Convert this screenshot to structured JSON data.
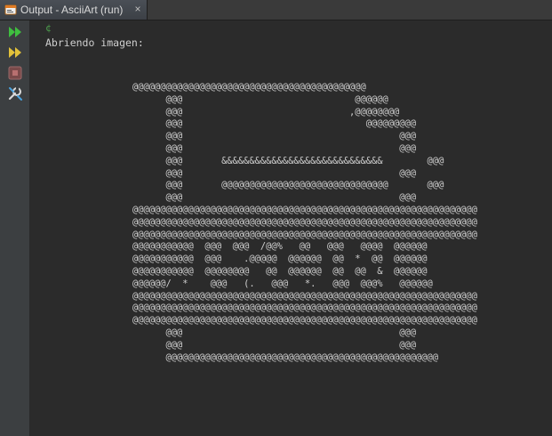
{
  "tab": {
    "title": "Output - AsciiArt (run)",
    "close_glyph": "×",
    "icon": "output-window-icon"
  },
  "toolbar": {
    "items": [
      {
        "icon": "rerun-icon",
        "label": "Re-run"
      },
      {
        "icon": "rerun-with-params-icon",
        "label": "Re-run with different parameters"
      },
      {
        "icon": "stop-icon",
        "label": "Stop"
      },
      {
        "icon": "settings-icon",
        "label": "Settings"
      }
    ]
  },
  "console": {
    "first_char": "¢",
    "message": "Abriendo imagen:",
    "ascii_art": "@@@@@@@@@@@@@@@@@@@@@@@@@@@@@@@@@@@@@@@@@@\n      @@@                               @@@@@@\n      @@@                              ,@@@@@@@@\n      @@@                                 @@@@@@@@@\n      @@@                                       @@@\n      @@@                                       @@@\n      @@@       &&&&&&&&&&&&&&&&&&&&&&&&&&&&&        @@@\n      @@@                                       @@@\n      @@@       @@@@@@@@@@@@@@@@@@@@@@@@@@@@@@       @@@\n      @@@                                       @@@\n@@@@@@@@@@@@@@@@@@@@@@@@@@@@@@@@@@@@@@@@@@@@@@@@@@@@@@@@@@@@@@\n@@@@@@@@@@@@@@@@@@@@@@@@@@@@@@@@@@@@@@@@@@@@@@@@@@@@@@@@@@@@@@\n@@@@@@@@@@@@@@@@@@@@@@@@@@@@@@@@@@@@@@@@@@@@@@@@@@@@@@@@@@@@@@\n@@@@@@@@@@@  @@@  @@@  /@@%   @@   @@@   @@@@  @@@@@@\n@@@@@@@@@@@  @@@    .@@@@@  @@@@@@  @@  *  @@  @@@@@@\n@@@@@@@@@@@  @@@@@@@@   @@  @@@@@@  @@  @@  &  @@@@@@\n@@@@@@/  *    @@@   (.   @@@   *.   @@@  @@@%   @@@@@@\n@@@@@@@@@@@@@@@@@@@@@@@@@@@@@@@@@@@@@@@@@@@@@@@@@@@@@@@@@@@@@@\n@@@@@@@@@@@@@@@@@@@@@@@@@@@@@@@@@@@@@@@@@@@@@@@@@@@@@@@@@@@@@@\n@@@@@@@@@@@@@@@@@@@@@@@@@@@@@@@@@@@@@@@@@@@@@@@@@@@@@@@@@@@@@@\n      @@@                                       @@@\n      @@@                                       @@@\n      @@@@@@@@@@@@@@@@@@@@@@@@@@@@@@@@@@@@@@@@@@@@@@@@@"
  },
  "colors": {
    "background": "#2b2b2b",
    "text": "#cfcfcf",
    "toolbar": "#3c3f41",
    "accent_green": "#4ea04e",
    "stop_red": "#c94e4e"
  }
}
